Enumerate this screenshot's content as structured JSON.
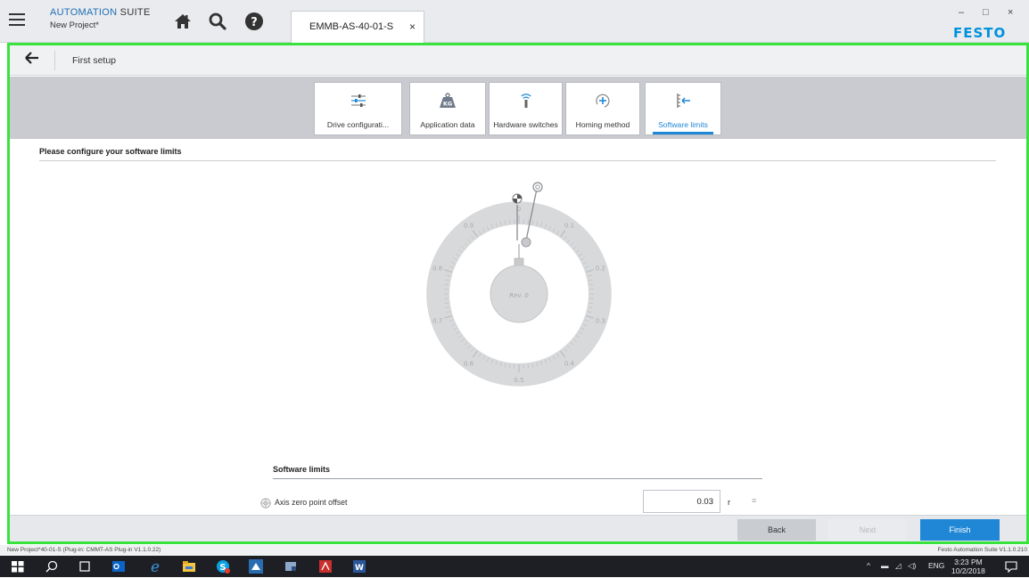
{
  "app": {
    "name_part1": "AUTOMATION",
    "name_part2": " SUITE",
    "project": "New Project*",
    "brand": "FESTO",
    "accent_color": "#1f87d6",
    "frame_color": "#39e33e"
  },
  "toolbar_icons": [
    "hamburger-icon",
    "home-icon",
    "search-icon",
    "help-icon"
  ],
  "tab": {
    "label": "EMMB-AS-40-01-S",
    "close": "×"
  },
  "window_controls": {
    "minimize": "–",
    "maximize": "□",
    "close": "×"
  },
  "nav": {
    "title": "First setup"
  },
  "steps": [
    {
      "label": "Drive configurati...",
      "icon": "sliders-icon",
      "active": false
    },
    {
      "label": "Application data",
      "icon": "weight-kg-icon",
      "active": false
    },
    {
      "label": "Hardware switches",
      "icon": "sensor-icon",
      "active": false
    },
    {
      "label": "Homing method",
      "icon": "homing-icon",
      "active": false
    },
    {
      "label": "Software limits",
      "icon": "software-limits-icon",
      "active": true
    }
  ],
  "main": {
    "heading": "Please configure your software limits",
    "dial": {
      "scale_labels": [
        "0",
        "0.1",
        "0.2",
        "0.3",
        "0.4",
        "0.5",
        "0.6",
        "0.7",
        "0.8",
        "0.9"
      ],
      "center_label": "Rev. 0"
    },
    "section_title": "Software limits",
    "param": {
      "label": "Axis zero point offset",
      "value": "0.03",
      "unit": "r",
      "extra": "≡"
    }
  },
  "footer": {
    "back": "Back",
    "next": "Next",
    "finish": "Finish"
  },
  "status": {
    "left": "New Project*40-01-S (Plug-in: CMMT-AS Plug-in V1.1.0.22)",
    "right": "Festo Automation Suite V1.1.0.210"
  },
  "taskbar": {
    "icons": [
      "windows-start-icon",
      "search-icon",
      "task-view-icon",
      "outlook-icon",
      "edge-icon",
      "file-explorer-icon",
      "skype-icon",
      "festo-app-icon",
      "app-icon",
      "acrobat-icon",
      "word-icon"
    ],
    "lang": "ENG",
    "time": "3:23 PM",
    "date": "10/2/2018"
  }
}
